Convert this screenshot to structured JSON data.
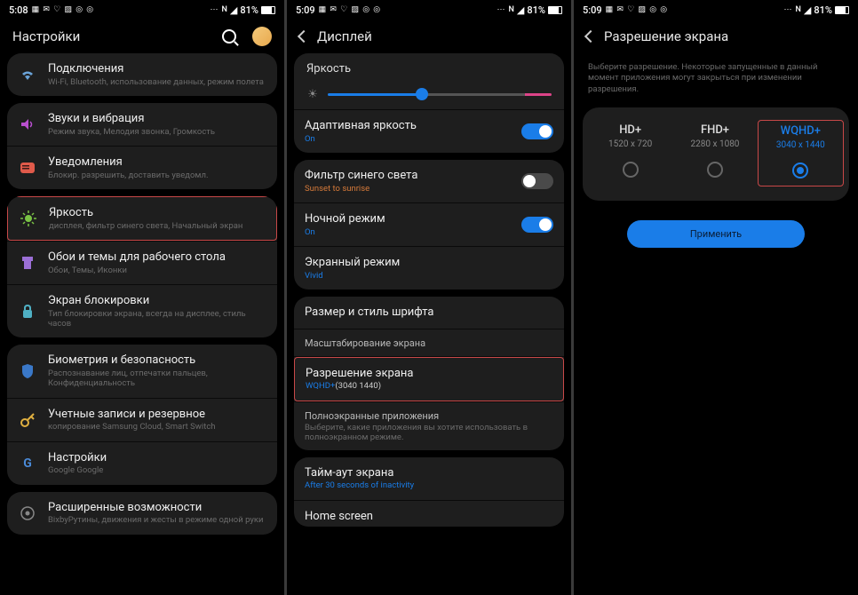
{
  "status": {
    "time1": "5:08",
    "time2": "5:09",
    "time3": "5:09",
    "icons_left": "▦ ✉ ♡ ▨ ◎ ◎",
    "icons_right": "⋯",
    "signal": "◢",
    "battery": "81%"
  },
  "screen1": {
    "title": "Настройки",
    "groups": [
      [
        {
          "icon": "wifi",
          "title": "Подключения",
          "sub": "Wi-Fi, Bluetooth, использование данных, режим полета"
        }
      ],
      [
        {
          "icon": "sound",
          "title": "Звуки и вибрация",
          "sub": "Режим звука, Мелодия звонка, Громкость"
        },
        {
          "icon": "notif",
          "title": "Уведомления",
          "sub": "Блокир. разрешить, доставить уведомл."
        }
      ],
      [
        {
          "icon": "bright",
          "title": "Яркость",
          "sub": "дисплея, фильтр синего света, Начальный экран",
          "red": true
        },
        {
          "icon": "theme",
          "title": "Обои и темы для рабочего стола",
          "sub": "Обои, Темы, Иконки"
        },
        {
          "icon": "lock",
          "title": "Экран блокировки",
          "sub": "Тип блокировки экрана, всегда на дисплее, стиль часов"
        }
      ],
      [
        {
          "icon": "bio",
          "title": "Биометрия и безопасность",
          "sub": "Распознавание лиц, отпечатки пальцев, Конфиденциальность"
        },
        {
          "icon": "key",
          "title": "Учетные записи и резервное",
          "sub": "копирование Samsung Cloud, Smart Switch"
        },
        {
          "icon": "google",
          "title": "Настройки",
          "sub": "Google Google"
        }
      ],
      [
        {
          "icon": "adv",
          "title": "Расширенные возможности",
          "sub": "BixbyРутины, движения и жесты в режиме одной руки"
        }
      ]
    ]
  },
  "screen2": {
    "title": "Дисплей",
    "brightness_label": "Яркость",
    "items": {
      "adaptive": {
        "title": "Адаптивная яркость",
        "sub": "On",
        "on": true
      },
      "bluefilter": {
        "title": "Фильтр синего света",
        "sub": "Sunset to sunrise",
        "on": false
      },
      "night": {
        "title": "Ночной режим",
        "sub": "On",
        "on": true
      },
      "mode": {
        "title": "Экранный режим",
        "sub": "Vivid"
      },
      "font": {
        "title": "Размер и стиль шрифта"
      },
      "zoom": {
        "title": "Масштабирование экрана"
      },
      "resolution": {
        "title": "Разрешение экрана",
        "sub_prefix": "WQHD+",
        "sub_value": "(3040 1440)",
        "red": true
      },
      "fullscreen": {
        "title": "Полноэкранные приложения",
        "sub": "Выберите, какие приложения вы хотите использовать в полноэкранном режиме."
      },
      "timeout": {
        "title": "Тайм-аут экрана",
        "sub": "After 30 seconds of inactivity"
      },
      "home": {
        "title": "Home screen"
      }
    }
  },
  "screen3": {
    "title": "Разрешение экрана",
    "help": "Выберите разрешение. Некоторые запущенные в данный момент приложения могут закрыться при изменении разрешения.",
    "options": [
      {
        "name": "HD+",
        "dim": "1520 x 720",
        "selected": false
      },
      {
        "name": "FHD+",
        "dim": "2280 x 1080",
        "selected": false
      },
      {
        "name": "WQHD+",
        "dim": "3040 x 1440",
        "selected": true
      }
    ],
    "apply": "Применить"
  },
  "colors": {
    "accent": "#1a7de8",
    "red": "#c84848",
    "orange": "#d67a3a"
  }
}
